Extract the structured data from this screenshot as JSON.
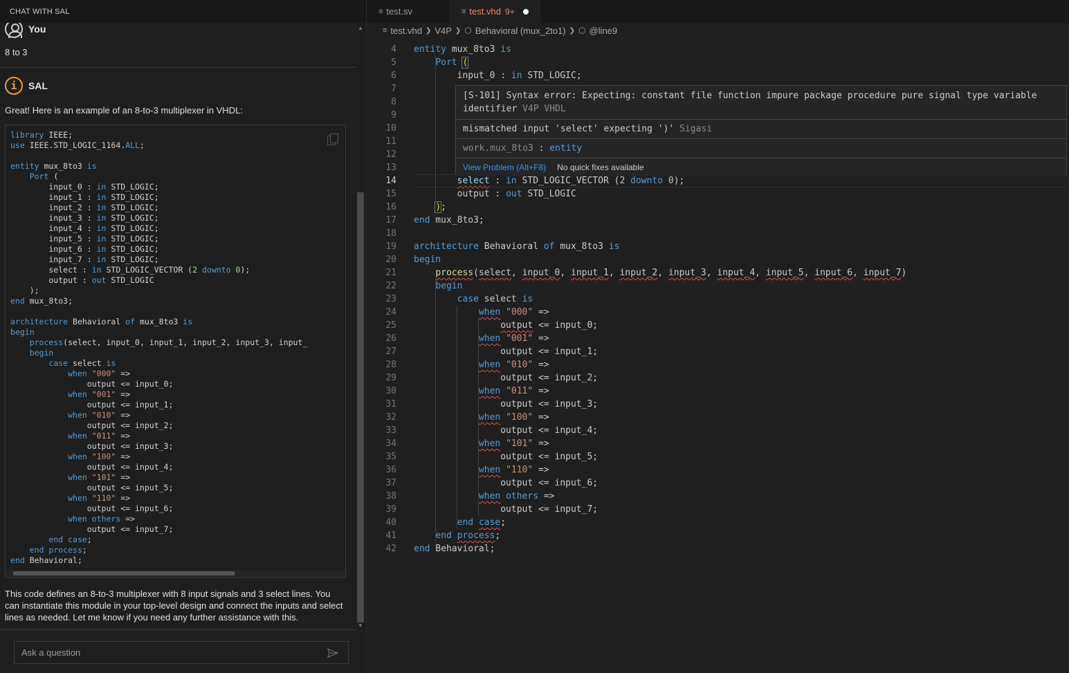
{
  "chat": {
    "header": "CHAT WITH SAL",
    "user_name": "You",
    "user_message": "8 to 3",
    "assistant_name": "SAL",
    "assistant_intro": "Great! Here is an example of an 8-to-3 multiplexer in VHDL:",
    "assistant_outro": "This code defines an 8-to-3 multiplexer with 8 input signals and 3 select lines. You can instantiate this module in your top-level design and connect the inputs and select lines as needed. Let me know if you need any further assistance with this.",
    "ask_placeholder": "Ask a question",
    "code_lines": [
      "library IEEE;",
      "use IEEE.STD_LOGIC_1164.ALL;",
      "",
      "entity mux_8to3 is",
      "    Port (",
      "        input_0 : in STD_LOGIC;",
      "        input_1 : in STD_LOGIC;",
      "        input_2 : in STD_LOGIC;",
      "        input_3 : in STD_LOGIC;",
      "        input_4 : in STD_LOGIC;",
      "        input_5 : in STD_LOGIC;",
      "        input_6 : in STD_LOGIC;",
      "        input_7 : in STD_LOGIC;",
      "        select : in STD_LOGIC_VECTOR (2 downto 0);",
      "        output : out STD_LOGIC",
      "    );",
      "end mux_8to3;",
      "",
      "architecture Behavioral of mux_8to3 is",
      "begin",
      "    process(select, input_0, input_1, input_2, input_3, input_",
      "    begin",
      "        case select is",
      "            when \"000\" =>",
      "                output <= input_0;",
      "            when \"001\" =>",
      "                output <= input_1;",
      "            when \"010\" =>",
      "                output <= input_2;",
      "            when \"011\" =>",
      "                output <= input_3;",
      "            when \"100\" =>",
      "                output <= input_4;",
      "            when \"101\" =>",
      "                output <= input_5;",
      "            when \"110\" =>",
      "                output <= input_6;",
      "            when others =>",
      "                output <= input_7;",
      "        end case;",
      "    end process;",
      "end Behavioral;"
    ]
  },
  "editor": {
    "tabs": [
      {
        "label": "test.sv",
        "active": false
      },
      {
        "label": "test.vhd",
        "active": true,
        "count": "9+"
      }
    ],
    "breadcrumb": [
      "test.vhd",
      "V4P",
      "Behavioral (mux_2to1)",
      "@line9"
    ],
    "current_line": "14",
    "lines": [
      {
        "n": "4",
        "code": "entity mux_8to3 is"
      },
      {
        "n": "5",
        "code": "    Port ("
      },
      {
        "n": "6",
        "code": "        input_0 : in STD_LOGIC;"
      },
      {
        "n": "7",
        "code": ""
      },
      {
        "n": "8",
        "code": ""
      },
      {
        "n": "9",
        "code": ""
      },
      {
        "n": "10",
        "code": ""
      },
      {
        "n": "11",
        "code": ""
      },
      {
        "n": "12",
        "code": ""
      },
      {
        "n": "13",
        "code": ""
      },
      {
        "n": "14",
        "code": "        select : in STD_LOGIC_VECTOR (2 downto 0);"
      },
      {
        "n": "15",
        "code": "        output : out STD_LOGIC"
      },
      {
        "n": "16",
        "code": "    );"
      },
      {
        "n": "17",
        "code": "end mux_8to3;"
      },
      {
        "n": "18",
        "code": ""
      },
      {
        "n": "19",
        "code": "architecture Behavioral of mux_8to3 is"
      },
      {
        "n": "20",
        "code": "begin"
      },
      {
        "n": "21",
        "code": "    process(select, input_0, input_1, input_2, input_3, input_4, input_5, input_6, input_7)"
      },
      {
        "n": "22",
        "code": "    begin"
      },
      {
        "n": "23",
        "code": "        case select is"
      },
      {
        "n": "24",
        "code": "            when \"000\" =>"
      },
      {
        "n": "25",
        "code": "                output <= input_0;"
      },
      {
        "n": "26",
        "code": "            when \"001\" =>"
      },
      {
        "n": "27",
        "code": "                output <= input_1;"
      },
      {
        "n": "28",
        "code": "            when \"010\" =>"
      },
      {
        "n": "29",
        "code": "                output <= input_2;"
      },
      {
        "n": "30",
        "code": "            when \"011\" =>"
      },
      {
        "n": "31",
        "code": "                output <= input_3;"
      },
      {
        "n": "32",
        "code": "            when \"100\" =>"
      },
      {
        "n": "33",
        "code": "                output <= input_4;"
      },
      {
        "n": "34",
        "code": "            when \"101\" =>"
      },
      {
        "n": "35",
        "code": "                output <= input_5;"
      },
      {
        "n": "36",
        "code": "            when \"110\" =>"
      },
      {
        "n": "37",
        "code": "                output <= input_6;"
      },
      {
        "n": "38",
        "code": "            when others =>"
      },
      {
        "n": "39",
        "code": "                output <= input_7;"
      },
      {
        "n": "40",
        "code": "        end case;"
      },
      {
        "n": "41",
        "code": "    end process;"
      },
      {
        "n": "42",
        "code": "end Behavioral;"
      }
    ],
    "hover": {
      "error_line1": "[S-101] Syntax error: Expecting: constant file function impure package procedure pure signal type variable",
      "error_line2": "identifier",
      "error_source": "V4P VHDL",
      "mismatch_text": "mismatched input 'select' expecting ')'",
      "mismatch_source": "Sigasi",
      "symbol_path": "work.mux_8to3",
      "symbol_colon": " : ",
      "symbol_kind": "entity",
      "view_problem": "View Problem (Alt+F8)",
      "no_fixes": "No quick fixes available"
    }
  }
}
